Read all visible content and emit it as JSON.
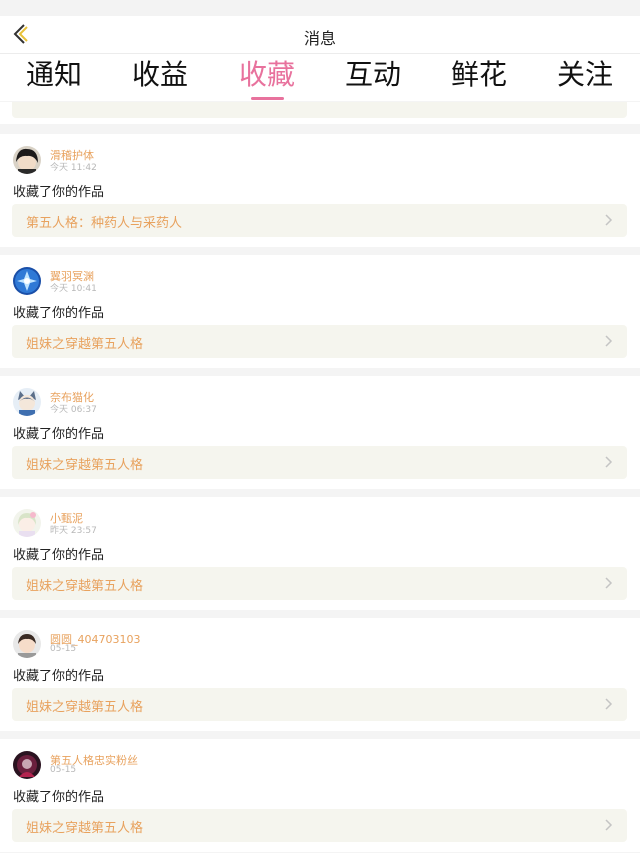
{
  "header": {
    "title": "消息"
  },
  "tabs": [
    {
      "label": "通知",
      "active": false
    },
    {
      "label": "收益",
      "active": false
    },
    {
      "label": "收藏",
      "active": true
    },
    {
      "label": "互动",
      "active": false
    },
    {
      "label": "鲜花",
      "active": false
    },
    {
      "label": "关注",
      "active": false
    }
  ],
  "colors": {
    "accent": "#e8729d",
    "username": "#e8a25e",
    "work_bg": "#f5f5ee"
  },
  "notifications": [
    {
      "user": "滑稽护体",
      "time": "今天 11:42",
      "action": "收藏了你的作品",
      "work": "第五人格：种药人与采药人",
      "avatar_icon": "dark-hair-avatar-icon"
    },
    {
      "user": "翼羽冥渊",
      "time": "今天 10:41",
      "action": "收藏了你的作品",
      "work": "姐妹之穿越第五人格",
      "avatar_icon": "blue-flower-avatar-icon"
    },
    {
      "user": "奈布猫化",
      "time": "今天 06:37",
      "action": "收藏了你的作品",
      "work": "姐妹之穿越第五人格",
      "avatar_icon": "cat-character-avatar-icon"
    },
    {
      "user": "小甄泥",
      "time": "昨天 23:57",
      "action": "收藏了你的作品",
      "work": "姐妹之穿越第五人格",
      "avatar_icon": "anime-girl-avatar-icon"
    },
    {
      "user": "圆圆_404703103",
      "time": "05-15",
      "action": "收藏了你的作品",
      "work": "姐妹之穿越第五人格",
      "avatar_icon": "boy-photo-avatar-icon"
    },
    {
      "user": "第五人格忠实粉丝",
      "time": "05-15",
      "action": "收藏了你的作品",
      "work": "姐妹之穿越第五人格",
      "avatar_icon": "dark-character-avatar-icon"
    }
  ]
}
